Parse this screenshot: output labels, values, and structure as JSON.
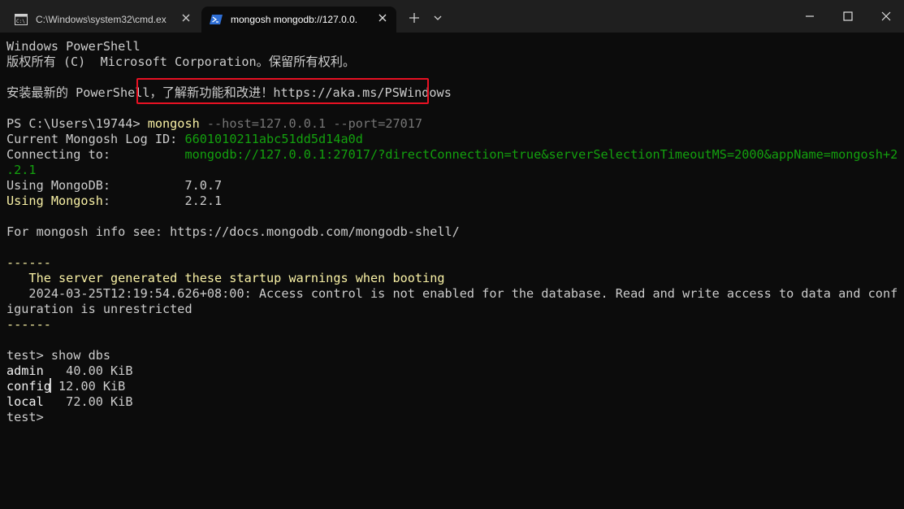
{
  "tabs": [
    {
      "label": "C:\\Windows\\system32\\cmd.ex",
      "icon": "cmd-icon",
      "active": false
    },
    {
      "label": "mongosh mongodb://127.0.0.",
      "icon": "powershell-icon",
      "active": true
    }
  ],
  "terminal": {
    "l1": "Windows PowerShell",
    "l2": "版权所有 (C)  Microsoft Corporation。保留所有权利。",
    "l3": "安装最新的 PowerShell，了解新功能和改进！https://aka.ms/PSWindows",
    "prompt": "PS C:\\Users\\19744> ",
    "cmd": "mongosh",
    "args": " --host=127.0.0.1 --port=27017",
    "log_label": "Current Mongosh Log ID: ",
    "log_value": "6601010211abc51dd5d14a0d",
    "conn_label": "Connecting to:          ",
    "conn_value": "mongodb://127.0.0.1:27017/?directConnection=true&serverSelectionTimeoutMS=2000&appName=mongosh+2",
    "conn_value2": ".2.1",
    "db_label": "Using MongoDB:          ",
    "db_value": "7.0.7",
    "mongosh_label": "Using Mongosh",
    "mongosh_colon": ":          ",
    "mongosh_value": "2.2.1",
    "info": "For mongosh info see: https://docs.mongodb.com/mongodb-shell/",
    "sep1": "------",
    "warn_title": "   The server generated these startup warnings when booting",
    "warn_line1": "   2024-03-25T12:19:54.626+08:00: Access control is not enabled for the database. Read and write access to data and conf",
    "warn_line2": "iguration is unrestricted",
    "sep2": "------",
    "test_prompt": "test> ",
    "show_cmd": "show dbs",
    "dbs": [
      {
        "name": "admin ",
        "pad": "  ",
        "size": "40.00 KiB"
      },
      {
        "name": "config",
        "pad": " ",
        "size": "12.00 KiB"
      },
      {
        "name": "local ",
        "pad": "  ",
        "size": "72.00 KiB"
      }
    ],
    "final_prompt": "test> "
  },
  "colors": {
    "background": "#0c0c0c",
    "text": "#cccccc",
    "yellow": "#f9f1a5",
    "green": "#13a10e",
    "highlight": "#e81123"
  }
}
